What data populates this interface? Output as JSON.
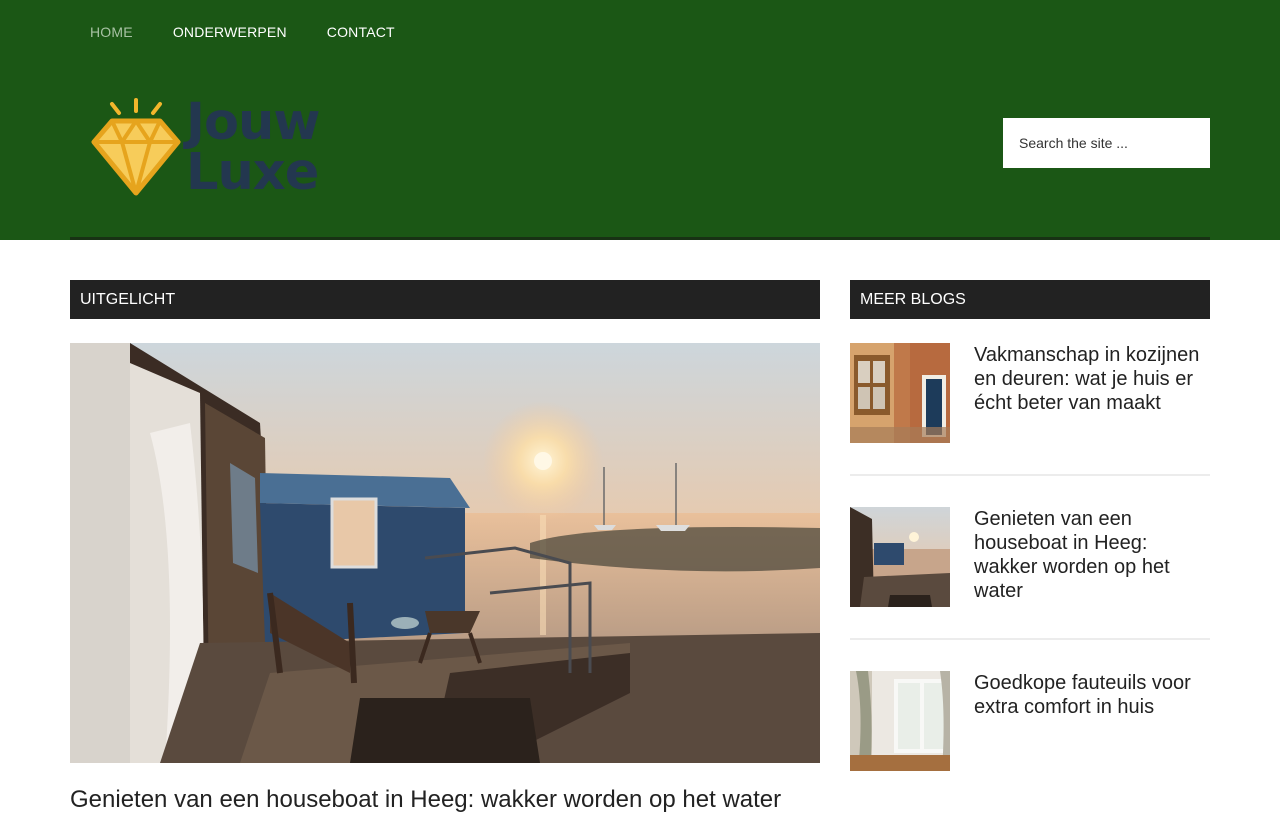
{
  "nav": {
    "items": [
      {
        "label": "HOME",
        "active": true
      },
      {
        "label": "ONDERWERPEN",
        "active": false
      },
      {
        "label": "CONTACT",
        "active": false
      }
    ]
  },
  "logo": {
    "line1": "Jouw",
    "line2": "Luxe",
    "icon": "diamond-icon",
    "gem_color": "#f2b62c",
    "text_color": "#23374f"
  },
  "search": {
    "placeholder": "Search the site ..."
  },
  "colors": {
    "header_bg": "#1b5715",
    "section_head_bg": "#222222"
  },
  "featured": {
    "heading": "UITGELICHT",
    "image": "houseboat-sunset-photo",
    "title": "Genieten van een houseboat in Heeg: wakker worden op het water"
  },
  "sidebar": {
    "heading": "MEER BLOGS",
    "posts": [
      {
        "title": "Vakmanschap in kozijnen en deuren: wat je huis er écht beter van maakt",
        "thumb": "brick-house-door-photo"
      },
      {
        "title": "Genieten van een houseboat in Heeg: wakker worden op het water",
        "thumb": "houseboat-sunset-photo"
      },
      {
        "title": "Goedkope fauteuils voor extra comfort in huis",
        "thumb": "living-room-window-photo"
      }
    ]
  }
}
